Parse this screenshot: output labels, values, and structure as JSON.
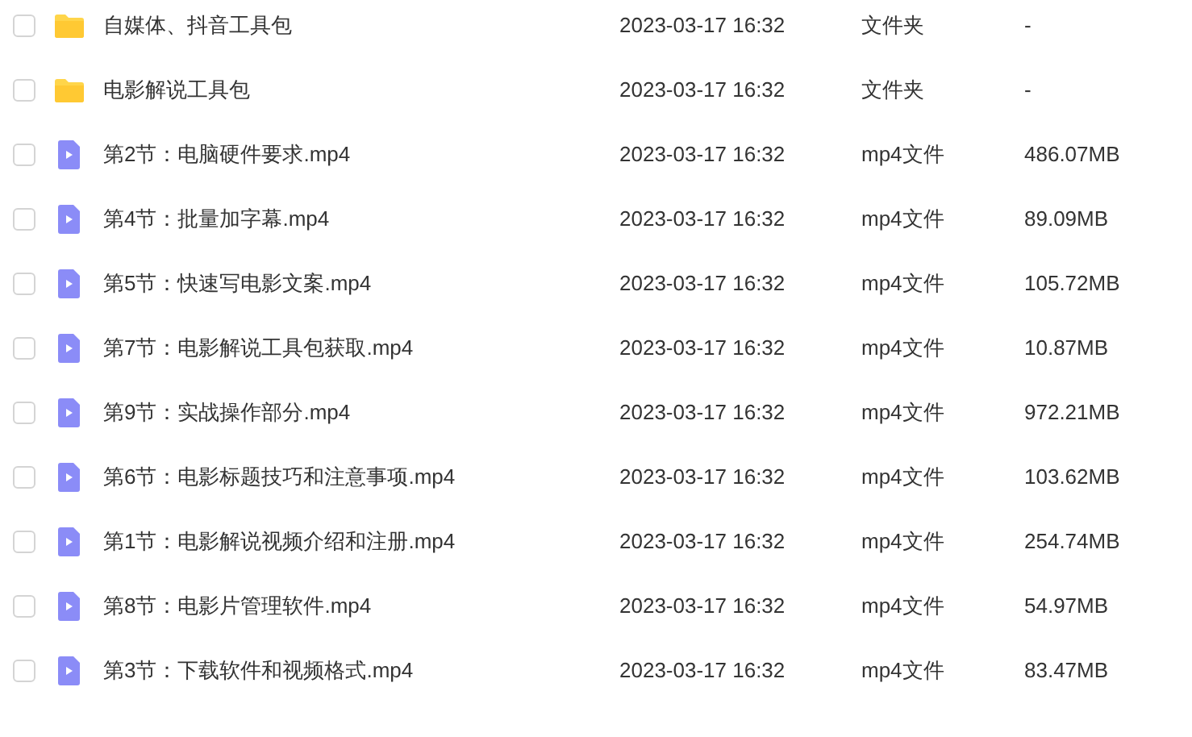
{
  "files": [
    {
      "kind": "folder",
      "checked": false,
      "name": "自媒体、抖音工具包",
      "modified": "2023-03-17 16:32",
      "type": "文件夹",
      "size": "-"
    },
    {
      "kind": "folder",
      "checked": false,
      "name": "电影解说工具包",
      "modified": "2023-03-17 16:32",
      "type": "文件夹",
      "size": "-"
    },
    {
      "kind": "video",
      "checked": false,
      "name": "第2节：电脑硬件要求.mp4",
      "modified": "2023-03-17 16:32",
      "type": "mp4文件",
      "size": "486.07MB"
    },
    {
      "kind": "video",
      "checked": false,
      "name": "第4节：批量加字幕.mp4",
      "modified": "2023-03-17 16:32",
      "type": "mp4文件",
      "size": "89.09MB"
    },
    {
      "kind": "video",
      "checked": false,
      "name": "第5节：快速写电影文案.mp4",
      "modified": "2023-03-17 16:32",
      "type": "mp4文件",
      "size": "105.72MB"
    },
    {
      "kind": "video",
      "checked": false,
      "name": "第7节：电影解说工具包获取.mp4",
      "modified": "2023-03-17 16:32",
      "type": "mp4文件",
      "size": "10.87MB"
    },
    {
      "kind": "video",
      "checked": false,
      "name": "第9节：实战操作部分.mp4",
      "modified": "2023-03-17 16:32",
      "type": "mp4文件",
      "size": "972.21MB"
    },
    {
      "kind": "video",
      "checked": false,
      "name": "第6节：电影标题技巧和注意事项.mp4",
      "modified": "2023-03-17 16:32",
      "type": "mp4文件",
      "size": "103.62MB"
    },
    {
      "kind": "video",
      "checked": false,
      "name": "第1节：电影解说视频介绍和注册.mp4",
      "modified": "2023-03-17 16:32",
      "type": "mp4文件",
      "size": "254.74MB"
    },
    {
      "kind": "video",
      "checked": false,
      "name": "第8节：电影片管理软件.mp4",
      "modified": "2023-03-17 16:32",
      "type": "mp4文件",
      "size": "54.97MB"
    },
    {
      "kind": "video",
      "checked": false,
      "name": "第3节：下载软件和视频格式.mp4",
      "modified": "2023-03-17 16:32",
      "type": "mp4文件",
      "size": "83.47MB"
    }
  ]
}
